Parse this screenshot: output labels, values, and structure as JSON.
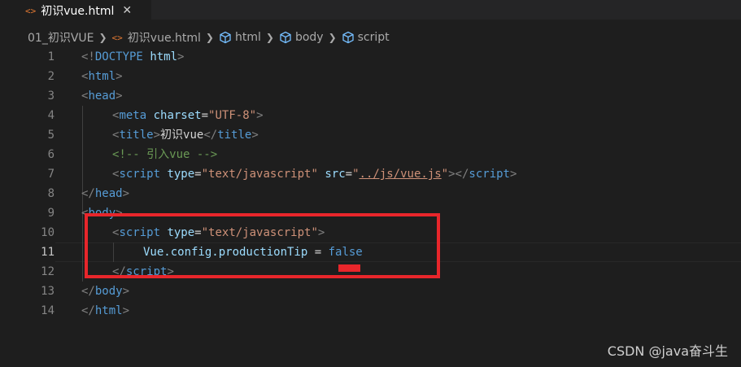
{
  "tab": {
    "icon": "<>",
    "label": "初识vue.html",
    "close": "✕"
  },
  "breadcrumb": {
    "folder": "01_初识VUE",
    "file": "初识vue.html",
    "items": [
      "html",
      "body",
      "script"
    ]
  },
  "lines": [
    {
      "n": "1"
    },
    {
      "n": "2"
    },
    {
      "n": "3"
    },
    {
      "n": "4"
    },
    {
      "n": "5"
    },
    {
      "n": "6"
    },
    {
      "n": "7"
    },
    {
      "n": "8"
    },
    {
      "n": "9"
    },
    {
      "n": "10"
    },
    {
      "n": "11"
    },
    {
      "n": "12"
    },
    {
      "n": "13"
    },
    {
      "n": "14"
    }
  ],
  "code": {
    "l1_open": "<!",
    "l1_doctype": "DOCTYPE",
    "l1_html": "html",
    "l1_close": ">",
    "l2_open": "<",
    "l2_tag": "html",
    "l2_close": ">",
    "l3_open": "<",
    "l3_tag": "head",
    "l3_close": ">",
    "l4_open": "<",
    "l4_tag": "meta",
    "l4_attr": "charset",
    "l4_eq": "=",
    "l4_val": "\"UTF-8\"",
    "l4_close": ">",
    "l5_open": "<",
    "l5_tag": "title",
    "l5_mid": ">",
    "l5_text": "初识vue",
    "l5_endopen": "</",
    "l5_endtag": "title",
    "l5_close": ">",
    "l6_comment": "<!-- 引入vue -->",
    "l7_open": "<",
    "l7_tag": "script",
    "l7_attr1": "type",
    "l7_eq1": "=",
    "l7_val1": "\"text/javascript\"",
    "l7_attr2": "src",
    "l7_eq2": "=",
    "l7_q1": "\"",
    "l7_path": "../js/vue.js",
    "l7_q2": "\"",
    "l7_mid": "></",
    "l7_endtag": "script",
    "l7_close": ">",
    "l8_open": "</",
    "l8_tag": "head",
    "l8_close": ">",
    "l9_open": "<",
    "l9_tag": "body",
    "l9_close": ">",
    "l10_open": "<",
    "l10_tag": "script",
    "l10_attr": "type",
    "l10_eq": "=",
    "l10_val": "\"text/javascript\"",
    "l10_close": ">",
    "l11_obj": "Vue.config.productionTip",
    "l11_op": " = ",
    "l11_val": "false",
    "l12_open": "</",
    "l12_tag": "script",
    "l12_close": ">",
    "l13_open": "</",
    "l13_tag": "body",
    "l13_close": ">",
    "l14_open": "</",
    "l14_tag": "html",
    "l14_close": ">"
  },
  "watermark": "CSDN @java奋斗生",
  "colors": {
    "background": "#1e1e1e",
    "tag": "#569cd6",
    "attribute": "#9cdcfe",
    "string": "#ce9178",
    "comment": "#6a9955",
    "highlight": "#e8262b"
  }
}
